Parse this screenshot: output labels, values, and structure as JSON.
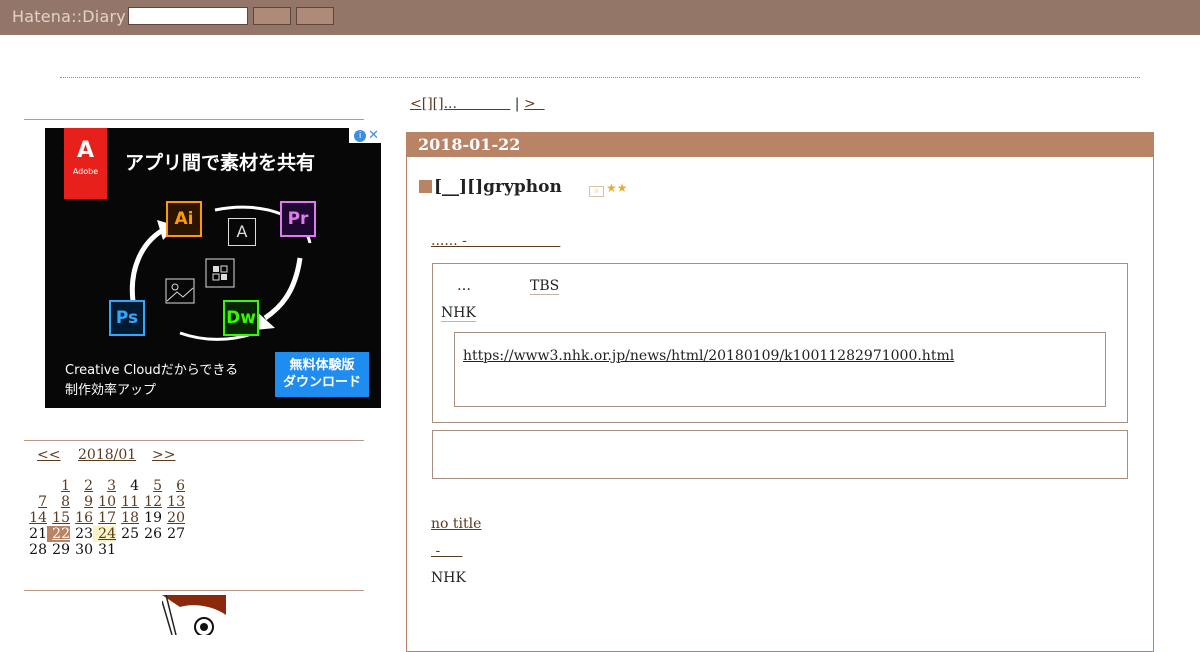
{
  "header": {
    "brand": "Hatena::Diary",
    "search_value": "",
    "btn1_label": "",
    "btn2_label": ""
  },
  "ad": {
    "brand_letter": "A",
    "brand_word": "Adobe",
    "headline": "アプリ間で素材を共有",
    "apps": [
      "Ai",
      "Pr",
      "Ps",
      "Dw"
    ],
    "center_icon": "A",
    "footer_line1": "Creative Cloudだからできる",
    "footer_line2": "制作効率アップ",
    "cta_line1": "無料体験版",
    "cta_line2": "ダウンロード",
    "info_glyph": "i",
    "close_glyph": "✕"
  },
  "calendar": {
    "prev": "<<",
    "month": "2018/01",
    "next": ">>",
    "rows": [
      [
        "",
        "1",
        "2",
        "3",
        "4",
        "5",
        "6"
      ],
      [
        "7",
        "8",
        "9",
        "10",
        "11",
        "12",
        "13"
      ],
      [
        "14",
        "15",
        "16",
        "17",
        "18",
        "19",
        "20"
      ],
      [
        "21",
        "22",
        "23",
        "24",
        "25",
        "26",
        "27"
      ],
      [
        "28",
        "29",
        "30",
        "31",
        "",
        "",
        ""
      ]
    ],
    "linked": [
      "1",
      "2",
      "3",
      "5",
      "6",
      "7",
      "8",
      "9",
      "10",
      "11",
      "12",
      "13",
      "14",
      "15",
      "16",
      "17",
      "18",
      "20",
      "22",
      "24"
    ],
    "today": "22",
    "highlight": "24"
  },
  "nav": {
    "prev_label": "<[][]...            ",
    "separator": "|",
    "next_label": ">  "
  },
  "entry": {
    "date": "2018-01-22",
    "section_title": "[__][]gryphon",
    "star_add": "☆",
    "stars": "★★",
    "lead_link": "...... -                     ",
    "quote": {
      "ellipsis": "…",
      "tbs": "TBS",
      "nhk": "NHK",
      "url": "https://www3.nhk.or.jp/news/html/20180109/k10011282971000.html"
    },
    "no_title": "no title",
    "dash_link": " -     ",
    "nhk2": "NHK"
  },
  "colors": {
    "topbar": "#937668",
    "accent": "#b98365",
    "link": "#5c3a1e"
  }
}
